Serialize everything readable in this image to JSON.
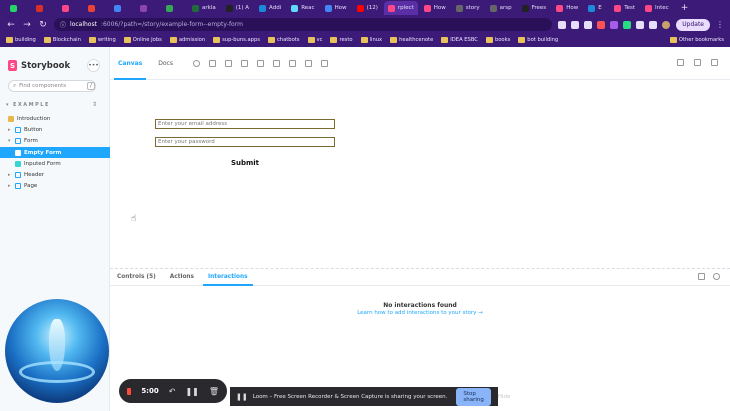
{
  "browser": {
    "tabs": [
      {
        "label": "",
        "color": "#25d366"
      },
      {
        "label": "",
        "color": "#d93025"
      },
      {
        "label": "",
        "color": "#ff4785"
      },
      {
        "label": "",
        "color": "#ea4335"
      },
      {
        "label": "",
        "color": "#4285f4"
      },
      {
        "label": "",
        "color": "#8e44ad"
      },
      {
        "label": "",
        "color": "#34a853"
      },
      {
        "label": "arkla",
        "color": "#1f6b3a"
      },
      {
        "label": "(1) A",
        "color": "#222222"
      },
      {
        "label": "Addi",
        "color": "#1c8adb"
      },
      {
        "label": "Reac",
        "color": "#61dafb"
      },
      {
        "label": "How",
        "color": "#4285f4"
      },
      {
        "label": "(12)",
        "color": "#ff0000"
      },
      {
        "label": "rplect",
        "color": "#ff4785"
      },
      {
        "label": "How",
        "color": "#ff4785"
      },
      {
        "label": "story",
        "color": "#666666"
      },
      {
        "label": "arsp",
        "color": "#666666"
      },
      {
        "label": "Frees",
        "color": "#222222"
      },
      {
        "label": "How",
        "color": "#ff4785"
      },
      {
        "label": "E",
        "color": "#1c8adb"
      },
      {
        "label": "Test",
        "color": "#ff4785"
      },
      {
        "label": "Intec",
        "color": "#ff4785"
      }
    ],
    "new_tab": "+",
    "address": {
      "host": "localhost",
      "path": ":6006/?path=/story/example-form--empty-form"
    },
    "update_label": "Update",
    "bookmarks": [
      "building",
      "Blockchain",
      "writing",
      "Online Jobs",
      "admission",
      "sup-buns.apps",
      "chatbots",
      "vc",
      "resto",
      "linux",
      "healthcenote",
      "IDEA ESBC",
      "books",
      "bot building"
    ],
    "other_bookmarks": "Other bookmarks"
  },
  "storybook": {
    "brand": "Storybook",
    "search_placeholder": "Find components",
    "search_shortcut": "/",
    "group_label": "EXAMPLE",
    "tree": [
      {
        "label": "Introduction",
        "kind": "doc",
        "level": 0
      },
      {
        "label": "Button",
        "kind": "component",
        "level": 0
      },
      {
        "label": "Form",
        "kind": "component",
        "level": 0
      },
      {
        "label": "Empty Form",
        "kind": "story",
        "level": 1,
        "selected": true
      },
      {
        "label": "Inputed Form",
        "kind": "story",
        "level": 1
      },
      {
        "label": "Header",
        "kind": "component",
        "level": 0
      },
      {
        "label": "Page",
        "kind": "component",
        "level": 0
      }
    ],
    "tabs": {
      "canvas": "Canvas",
      "docs": "Docs"
    },
    "form": {
      "email_placeholder": "Enter your email address",
      "password_placeholder": "Enter your password",
      "submit": "Submit"
    },
    "addons": {
      "tabs": [
        "Controls (5)",
        "Actions",
        "Interactions"
      ],
      "active_tab": "Interactions",
      "empty_title": "No interactions found",
      "learn_link": "Learn how to add interactions to your story →"
    }
  },
  "recorder": {
    "time": "5:00"
  },
  "loom": {
    "message": "Loom – Free Screen Recorder & Screen Capture is sharing your screen.",
    "stop": "Stop sharing",
    "hide": "Hide"
  },
  "colors": {
    "accent": "#1ea7fd",
    "brand": "#ff4785",
    "chrome": "#3c1a78"
  }
}
